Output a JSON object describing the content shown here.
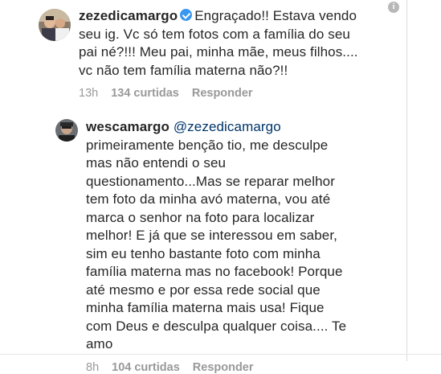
{
  "comments": [
    {
      "username": "zezedicamargo",
      "verified": true,
      "lines": [
        "Engraçado!! Estava vendo",
        "seu ig. Vc só tem fotos com a família do seu",
        "pai né?!!! Meu pai, minha mãe, meus filhos....",
        "vc não tem família materna não?!!"
      ],
      "time": "13h",
      "likes": "134 curtidas",
      "reply_label": "Responder"
    },
    {
      "username": "wescamargo",
      "mention": "@zezedicamargo",
      "lines": [
        "primeiramente benção tio, me desculpe",
        "mas não entendi o seu",
        "questionamento...Mas se reparar melhor",
        "tem foto da minha avó materna, vou até",
        "marca o senhor na foto para localizar",
        "melhor! E já que se interessou em saber,",
        "sim eu tenho bastante foto com minha",
        "família materna mas no facebook! Porque",
        "até mesmo e por essa rede social que",
        "minha família materna mais usa! Fique",
        "com Deus e desculpa qualquer coisa.... Te",
        "amo"
      ],
      "time": "8h",
      "likes": "104 curtidas",
      "reply_label": "Responder"
    }
  ],
  "icons": {
    "more": "info-icon",
    "more_glyph": "i",
    "verified": "verified-badge-icon"
  },
  "colors": {
    "text": "#262626",
    "meta": "#999999",
    "mention": "#003569",
    "verified": "#3897f0"
  }
}
